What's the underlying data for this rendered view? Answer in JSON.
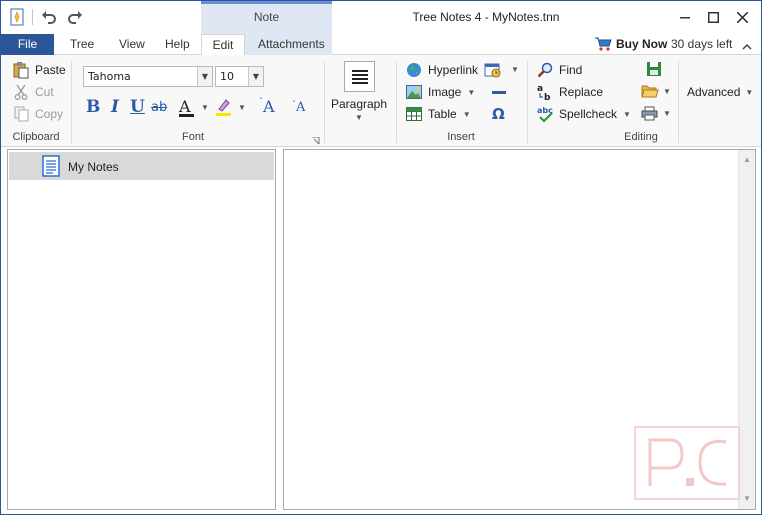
{
  "titlebar": {
    "title": "Tree Notes 4 - MyNotes.tnn",
    "context_tab_group": "Note"
  },
  "tabs": {
    "file": "File",
    "items": [
      "Tree",
      "View",
      "Help",
      "Edit",
      "Attachments"
    ],
    "active": "Edit"
  },
  "promo": {
    "buy_now": "Buy Now",
    "days_left": "30 days left"
  },
  "ribbon": {
    "clipboard": {
      "label": "Clipboard",
      "paste": "Paste",
      "cut": "Cut",
      "copy": "Copy"
    },
    "font": {
      "label": "Font",
      "family": "Tahoma",
      "size": "10",
      "bold": "B",
      "italic": "I",
      "underline": "U",
      "strike": "ab",
      "font_color": "A",
      "grow": "A",
      "shrink": "A"
    },
    "paragraph": {
      "label": "Paragraph"
    },
    "insert": {
      "label": "Insert",
      "hyperlink": "Hyperlink",
      "image": "Image",
      "table": "Table",
      "omega": "Ω"
    },
    "editing": {
      "label": "Editing",
      "find": "Find",
      "replace": "Replace",
      "spellcheck": "Spellcheck",
      "advanced": "Advanced"
    }
  },
  "tree": {
    "items": [
      {
        "label": "My Notes",
        "selected": true
      }
    ]
  },
  "colors": {
    "accent": "#2b579a",
    "context_tab": "#dfe7f5",
    "selection": "#d9d9d9"
  }
}
